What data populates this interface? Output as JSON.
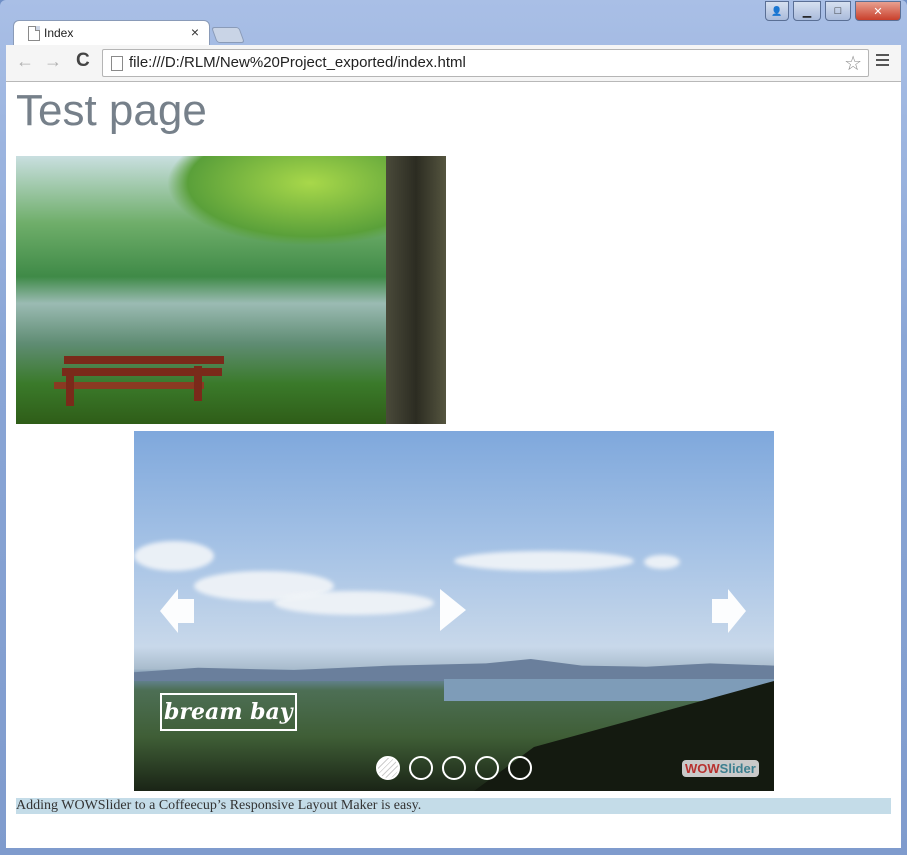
{
  "window": {
    "tab_title": "Index",
    "tab_close": "×",
    "controls": {
      "profile": "👤",
      "minimize": "▁",
      "maximize": "□",
      "close": "✕"
    },
    "close_color": "#c9402c"
  },
  "toolbar": {
    "back": "←",
    "forward": "→",
    "reload": "C",
    "url": "file:///D:/RLM/New%20Project_exported/index.html",
    "star": "☆"
  },
  "page": {
    "title": "Test page",
    "image_alt": "Park bench by a lake under a tree",
    "slider": {
      "caption": "bream bay",
      "prev_icon": "arrow-left",
      "next_icon": "arrow-right",
      "play_icon": "play-triangle",
      "slide_count": 5,
      "active_slide": 1,
      "watermark_wow": "WOW",
      "watermark_slider": "Slider",
      "watermark_wow_color": "#b8312f",
      "watermark_slider_color": "#3d7f8f"
    },
    "footer_text": "Adding WOWSlider to a  Coffeecup’s Responsive Layout Maker is easy.",
    "footer_bg": "#c4dce8"
  }
}
